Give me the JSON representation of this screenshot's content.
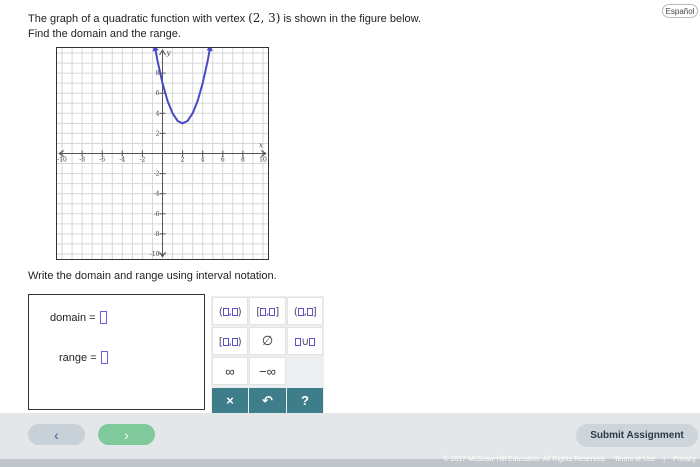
{
  "header": {
    "language_button": "Español"
  },
  "question": {
    "line1_before": "The graph of a quadratic function with vertex ",
    "vertex": "(2, 3)",
    "line1_after": " is shown in the figure below.",
    "line2": "Find the domain and the range."
  },
  "graph": {
    "x_axis_label": "x",
    "y_axis_label": "y",
    "x_ticks": [
      "-10",
      "-8",
      "-6",
      "-4",
      "-2",
      "2",
      "4",
      "6",
      "8",
      "10"
    ],
    "y_ticks": [
      "8",
      "6",
      "4",
      "2",
      "-2",
      "-4",
      "-6",
      "-8",
      "-10"
    ],
    "chart_data": {
      "type": "line",
      "function": "y = (x - 2)^2 + 3",
      "vertex": [
        2,
        3
      ],
      "xlim": [
        -10.5,
        10.5
      ],
      "ylim": [
        -10.5,
        10.5
      ],
      "x": [
        -0.8,
        -0.5,
        0,
        0.5,
        1,
        1.5,
        2,
        2.5,
        3,
        3.5,
        4,
        4.5,
        4.8
      ],
      "y": [
        10.84,
        9.25,
        7,
        5.25,
        4,
        3.25,
        3,
        3.25,
        4,
        5.25,
        7,
        9.25,
        10.84
      ],
      "grid": true,
      "arrows": "both-ends",
      "color": "#4a49c4"
    }
  },
  "instructions": "Write the domain and range using interval notation.",
  "answer": {
    "domain_label": "domain =",
    "range_label": "range ="
  },
  "keypad": {
    "infinity": "∞",
    "neg_infinity": "−∞",
    "empty_set": "∅",
    "clear": "×",
    "undo": "↶",
    "help": "?"
  },
  "footer": {
    "prev": "‹",
    "next": "›",
    "submit": "Submit Assignment",
    "copyright": "© 2017 McGraw-Hill Education. All Rights Reserved.",
    "terms": "Terms of Use",
    "separator": "|",
    "privacy": "Privacy"
  }
}
